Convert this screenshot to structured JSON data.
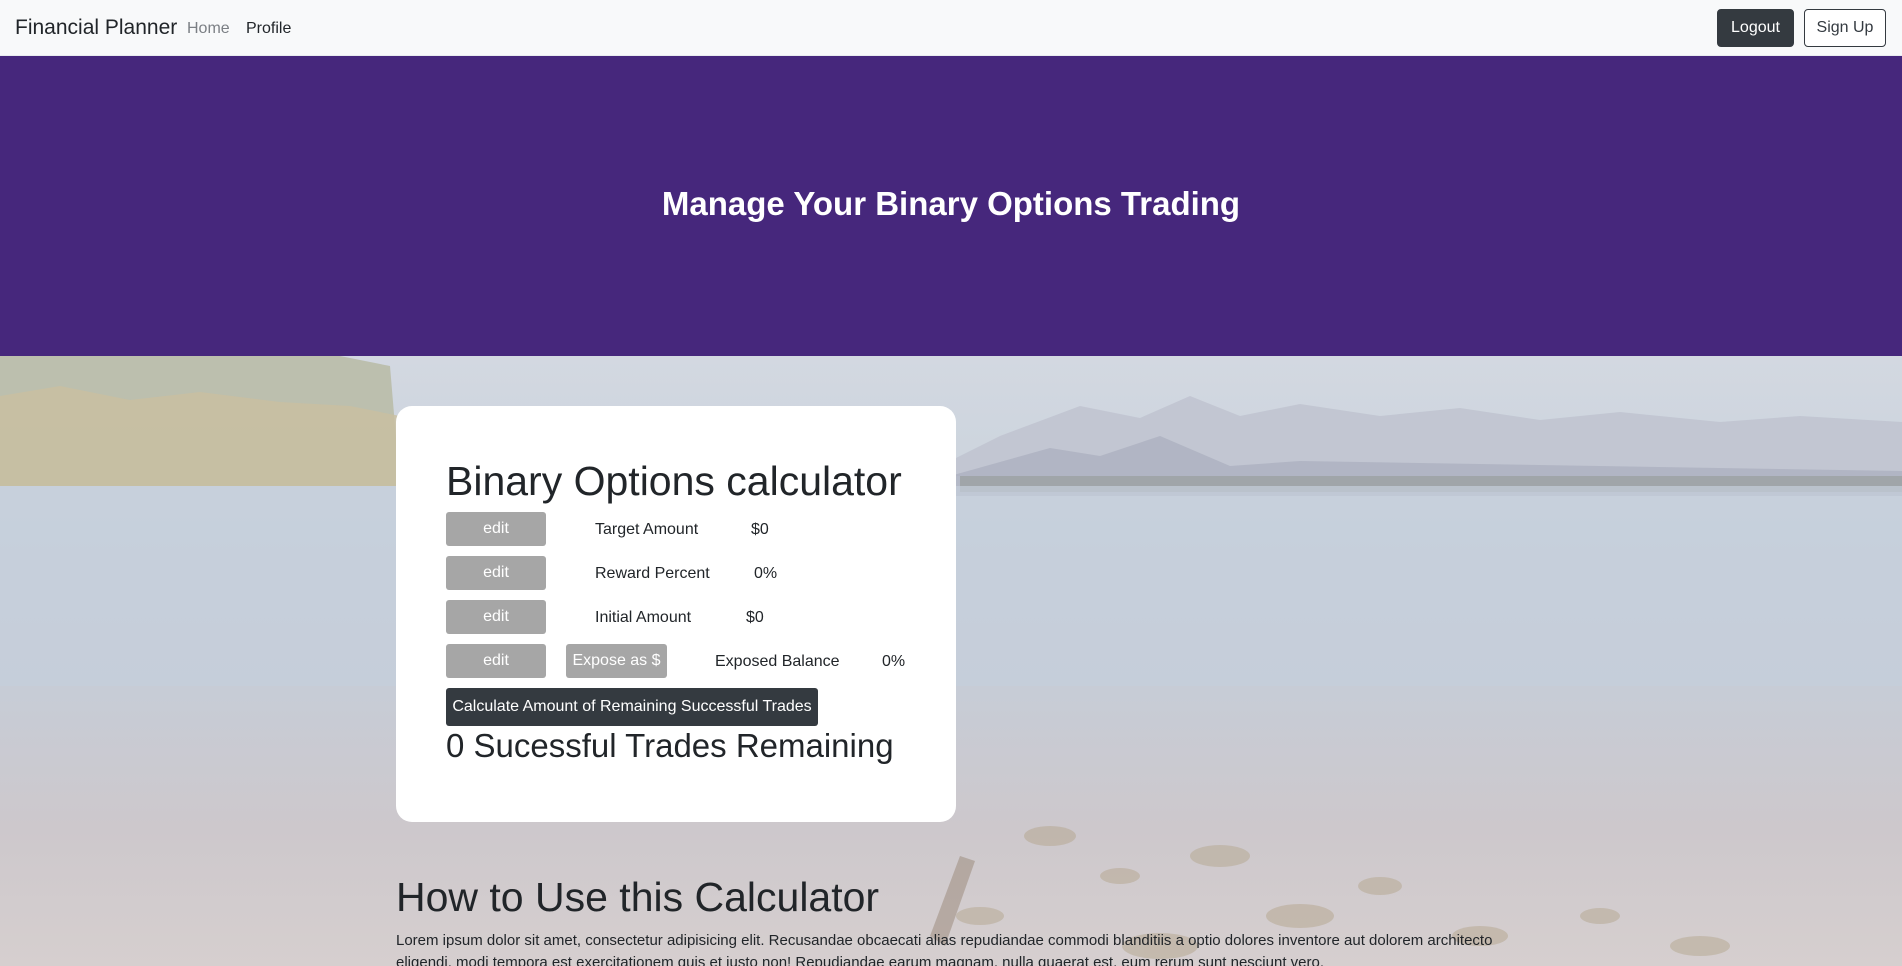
{
  "nav": {
    "brand": "Financial Planner",
    "links": [
      "Home",
      "Profile"
    ],
    "logout": "Logout",
    "signup": "Sign Up"
  },
  "hero": {
    "title": "Manage Your Binary Options Trading"
  },
  "calculator": {
    "title": "Binary Options calculator",
    "rows": [
      {
        "button": "edit",
        "label": "Target Amount",
        "value": "$0"
      },
      {
        "button": "edit",
        "label": "Reward Percent",
        "value": "0%"
      },
      {
        "button": "edit",
        "label": "Initial Amount",
        "value": "$0"
      },
      {
        "button": "edit",
        "extra_button": "Expose as $",
        "label": "Exposed Balance",
        "value": "0%"
      }
    ],
    "calculate_button": "Calculate Amount of Remaining Successful Trades",
    "result": "0 Sucessful Trades Remaining"
  },
  "howto": {
    "title": "How to Use this Calculator",
    "text": "Lorem ipsum dolor sit amet, consectetur adipisicing elit. Recusandae obcaecati alias repudiandae commodi blanditiis a optio dolores inventore aut dolorem architecto eligendi, modi tempora est exercitationem quis et iusto non! Repudiandae earum magnam, nulla quaerat est, eum rerum sunt nesciunt vero."
  },
  "colors": {
    "hero": "#46277c",
    "dark_button": "#343a40",
    "edit_button": "#a6a6a6"
  }
}
